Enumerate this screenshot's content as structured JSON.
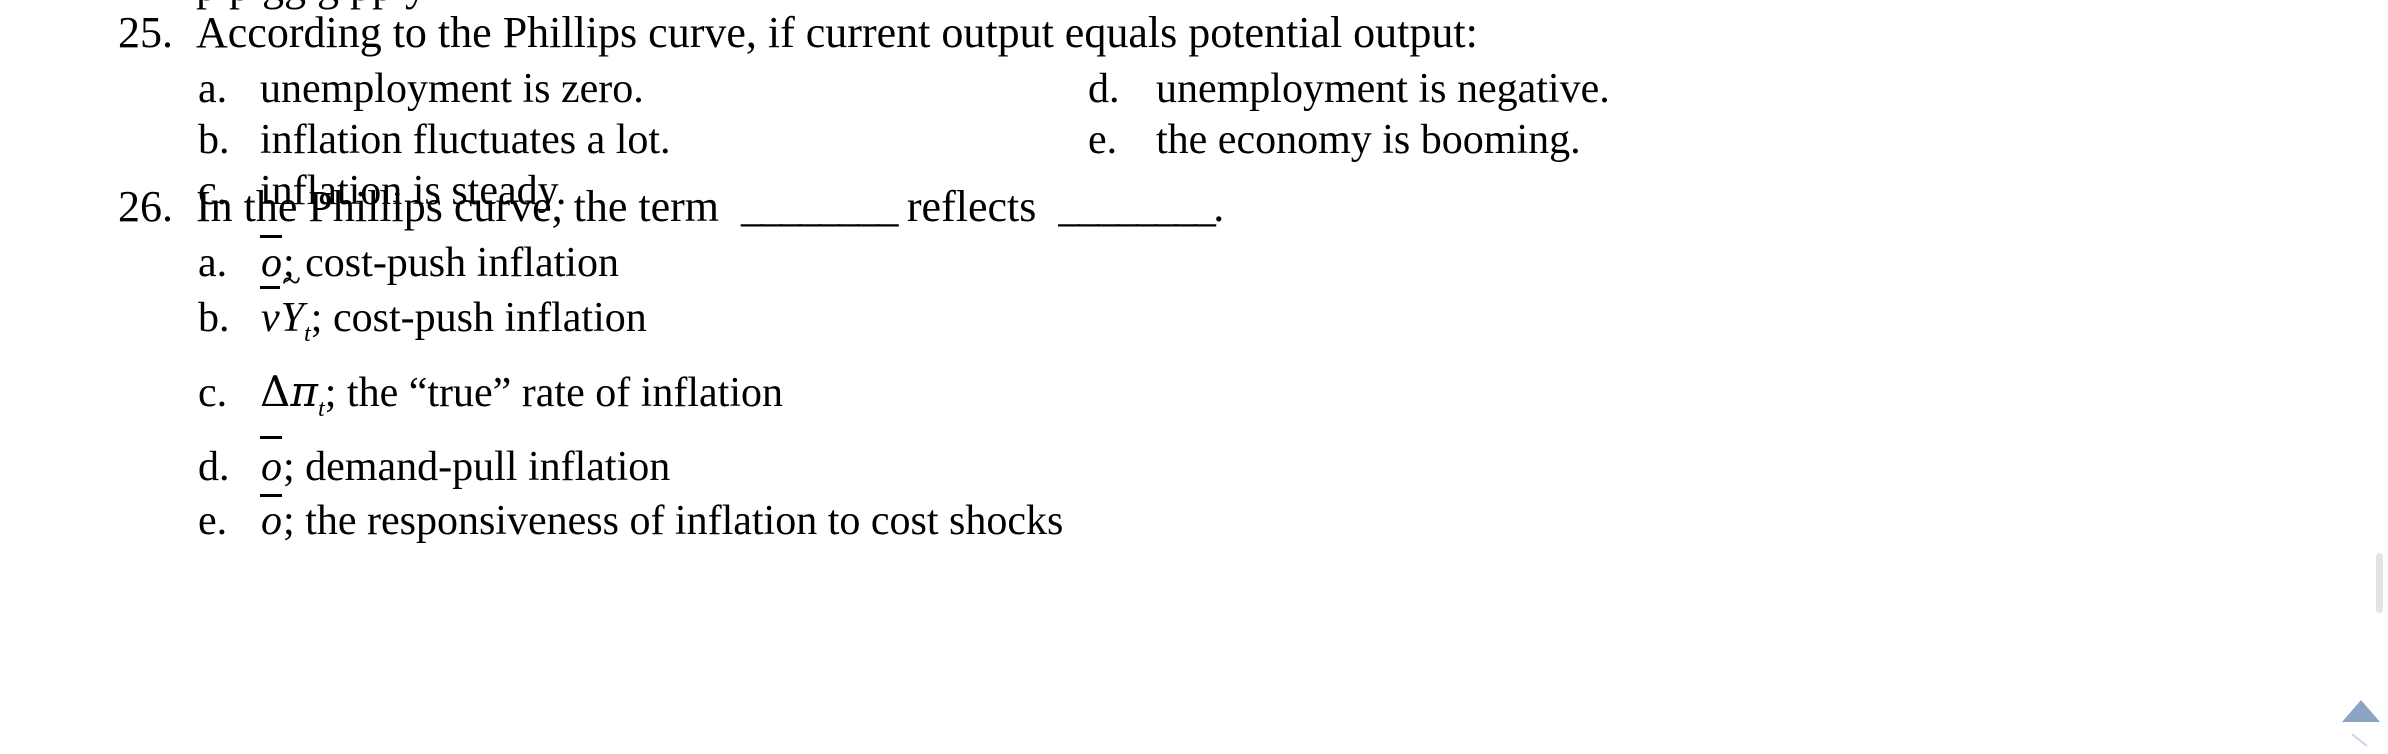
{
  "document": {
    "clipped_previous_line": "p     p        gg g      pp y",
    "questions": [
      {
        "number": "25.",
        "stem": "According to the Phillips curve, if current output equals potential output:",
        "options_left": [
          {
            "letter": "a.",
            "text": "unemployment is zero."
          },
          {
            "letter": "b.",
            "text": "inflation fluctuates a lot."
          },
          {
            "letter": "c.",
            "text": "inflation is steady."
          }
        ],
        "options_right": [
          {
            "letter": "d.",
            "text": "unemployment is negative."
          },
          {
            "letter": "e.",
            "text": "the economy is booming."
          }
        ]
      },
      {
        "number": "26.",
        "stem_part1": "In the Phillips curve, the term",
        "blank1": "________",
        "stem_part2": "reflects",
        "blank2": "________",
        "stem_part3": ".",
        "options": [
          {
            "letter": "a.",
            "symbol_type": "o-bar",
            "symbol_text": "o",
            "text": "; cost-push inflation"
          },
          {
            "letter": "b.",
            "symbol_type": "v-bar-Y-tilde-t",
            "symbol_v": "v",
            "symbol_Y": "Y",
            "symbol_sub": "t",
            "text": "; cost-push inflation"
          },
          {
            "letter": "c.",
            "symbol_type": "delta-pi-t",
            "symbol_delta": "Δ",
            "symbol_pi": "π",
            "symbol_sub": "t",
            "text": "; the “true” rate of inflation"
          },
          {
            "letter": "d.",
            "symbol_type": "o-bar",
            "symbol_text": "o",
            "text": "; demand-pull inflation"
          },
          {
            "letter": "e.",
            "symbol_type": "o-bar",
            "symbol_text": "o",
            "text": "; the responsiveness of inflation to cost shocks"
          }
        ]
      }
    ]
  },
  "scrollbar": {
    "thumb_color": "#e3e3e3",
    "arrow_color": "#8ba4c6"
  }
}
